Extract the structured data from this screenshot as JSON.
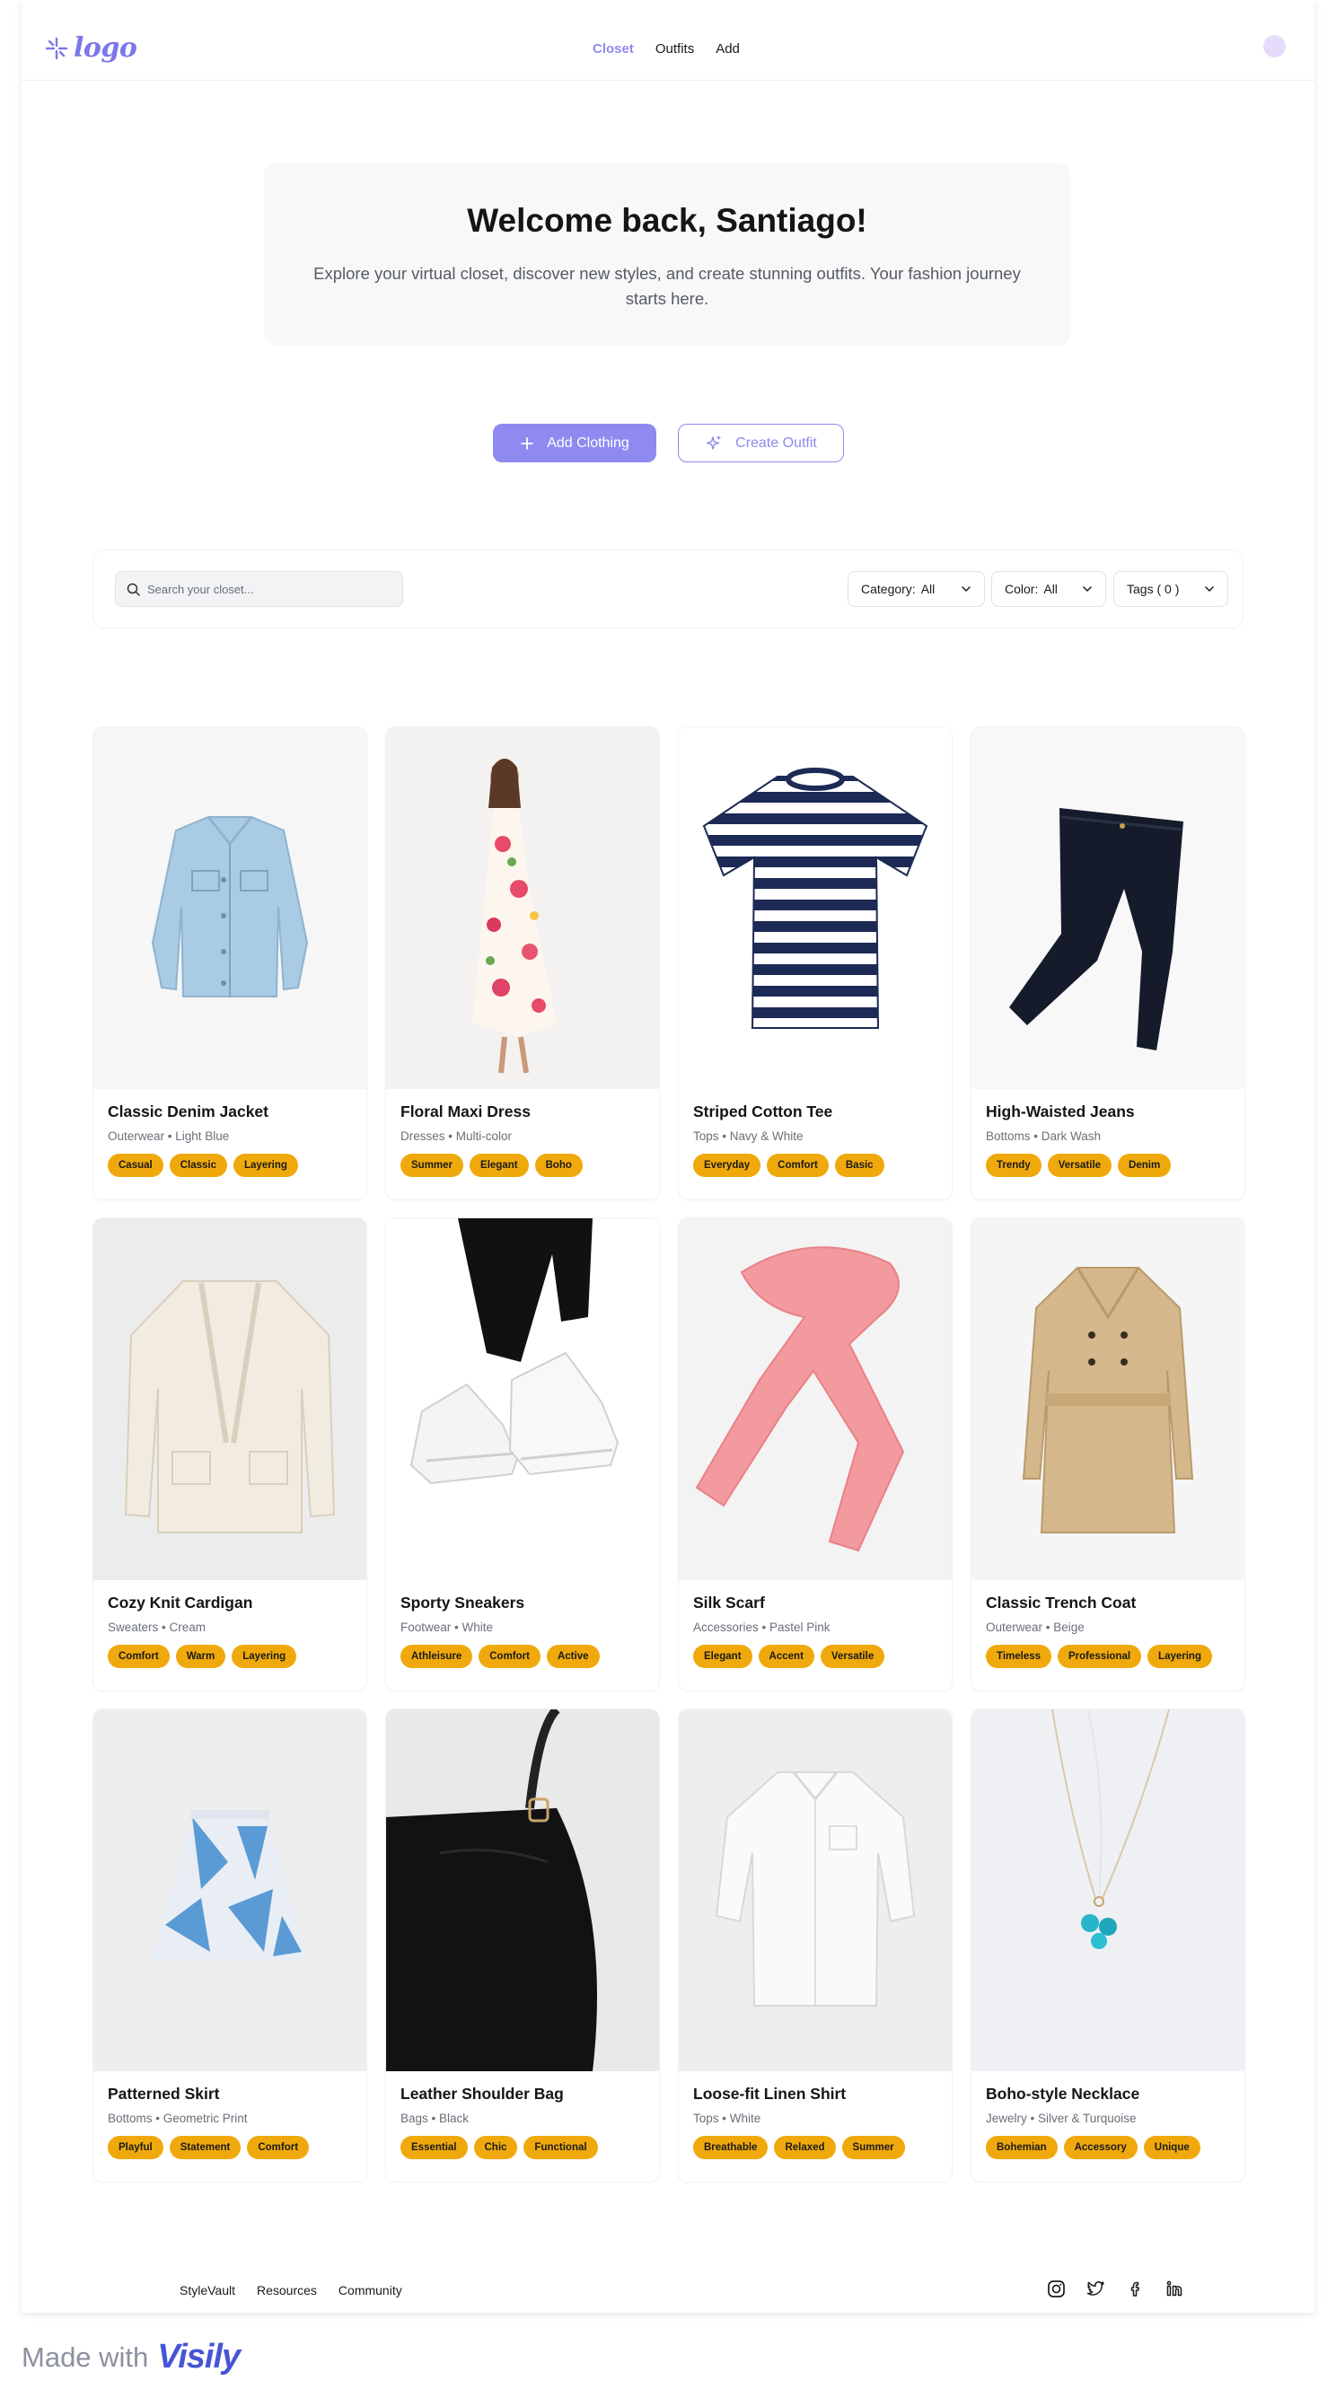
{
  "header": {
    "logo_text": "logo",
    "nav": [
      {
        "label": "Closet",
        "active": true
      },
      {
        "label": "Outfits",
        "active": false
      },
      {
        "label": "Add",
        "active": false
      }
    ]
  },
  "welcome": {
    "title": "Welcome back, Santiago!",
    "text": "Explore your virtual closet, discover new styles, and create stunning outfits. Your fashion journey starts here."
  },
  "actions": {
    "add_clothing": "Add Clothing",
    "create_outfit": "Create Outfit"
  },
  "filters": {
    "search_placeholder": "Search your closet...",
    "category_label": "Category:",
    "category_value": "All",
    "color_label": "Color:",
    "color_value": "All",
    "tags_label": "Tags ( 0 )"
  },
  "items": [
    {
      "title": "Classic Denim Jacket",
      "meta": "Outerwear • Light Blue",
      "tags": [
        "Casual",
        "Classic",
        "Layering"
      ],
      "image": "denim-jacket"
    },
    {
      "title": "Floral Maxi Dress",
      "meta": "Dresses • Multi-color",
      "tags": [
        "Summer",
        "Elegant",
        "Boho"
      ],
      "image": "floral-dress"
    },
    {
      "title": "Striped Cotton Tee",
      "meta": "Tops • Navy & White",
      "tags": [
        "Everyday",
        "Comfort",
        "Basic"
      ],
      "image": "striped-tee"
    },
    {
      "title": "High-Waisted Jeans",
      "meta": "Bottoms • Dark Wash",
      "tags": [
        "Trendy",
        "Versatile",
        "Denim"
      ],
      "image": "jeans"
    },
    {
      "title": "Cozy Knit Cardigan",
      "meta": "Sweaters • Cream",
      "tags": [
        "Comfort",
        "Warm",
        "Layering"
      ],
      "image": "cardigan"
    },
    {
      "title": "Sporty Sneakers",
      "meta": "Footwear • White",
      "tags": [
        "Athleisure",
        "Comfort",
        "Active"
      ],
      "image": "sneakers"
    },
    {
      "title": "Silk Scarf",
      "meta": "Accessories • Pastel Pink",
      "tags": [
        "Elegant",
        "Accent",
        "Versatile"
      ],
      "image": "scarf"
    },
    {
      "title": "Classic Trench Coat",
      "meta": "Outerwear • Beige",
      "tags": [
        "Timeless",
        "Professional",
        "Layering"
      ],
      "image": "trench-coat"
    },
    {
      "title": "Patterned Skirt",
      "meta": "Bottoms • Geometric Print",
      "tags": [
        "Playful",
        "Statement",
        "Comfort"
      ],
      "image": "skirt"
    },
    {
      "title": "Leather Shoulder Bag",
      "meta": "Bags • Black",
      "tags": [
        "Essential",
        "Chic",
        "Functional"
      ],
      "image": "bag"
    },
    {
      "title": "Loose-fit Linen Shirt",
      "meta": "Tops • White",
      "tags": [
        "Breathable",
        "Relaxed",
        "Summer"
      ],
      "image": "linen-shirt"
    },
    {
      "title": "Boho-style Necklace",
      "meta": "Jewelry • Silver & Turquoise",
      "tags": [
        "Bohemian",
        "Accessory",
        "Unique"
      ],
      "image": "necklace"
    }
  ],
  "footer": {
    "links": [
      "StyleVault",
      "Resources",
      "Community"
    ],
    "socials": [
      "instagram-icon",
      "twitter-icon",
      "facebook-icon",
      "linkedin-icon"
    ]
  },
  "badge": {
    "made_with": "Made with",
    "brand": "Visily"
  },
  "colors": {
    "accent": "#8e8af0",
    "tag": "#f0a90c",
    "avatar": "#e5dcfb"
  }
}
